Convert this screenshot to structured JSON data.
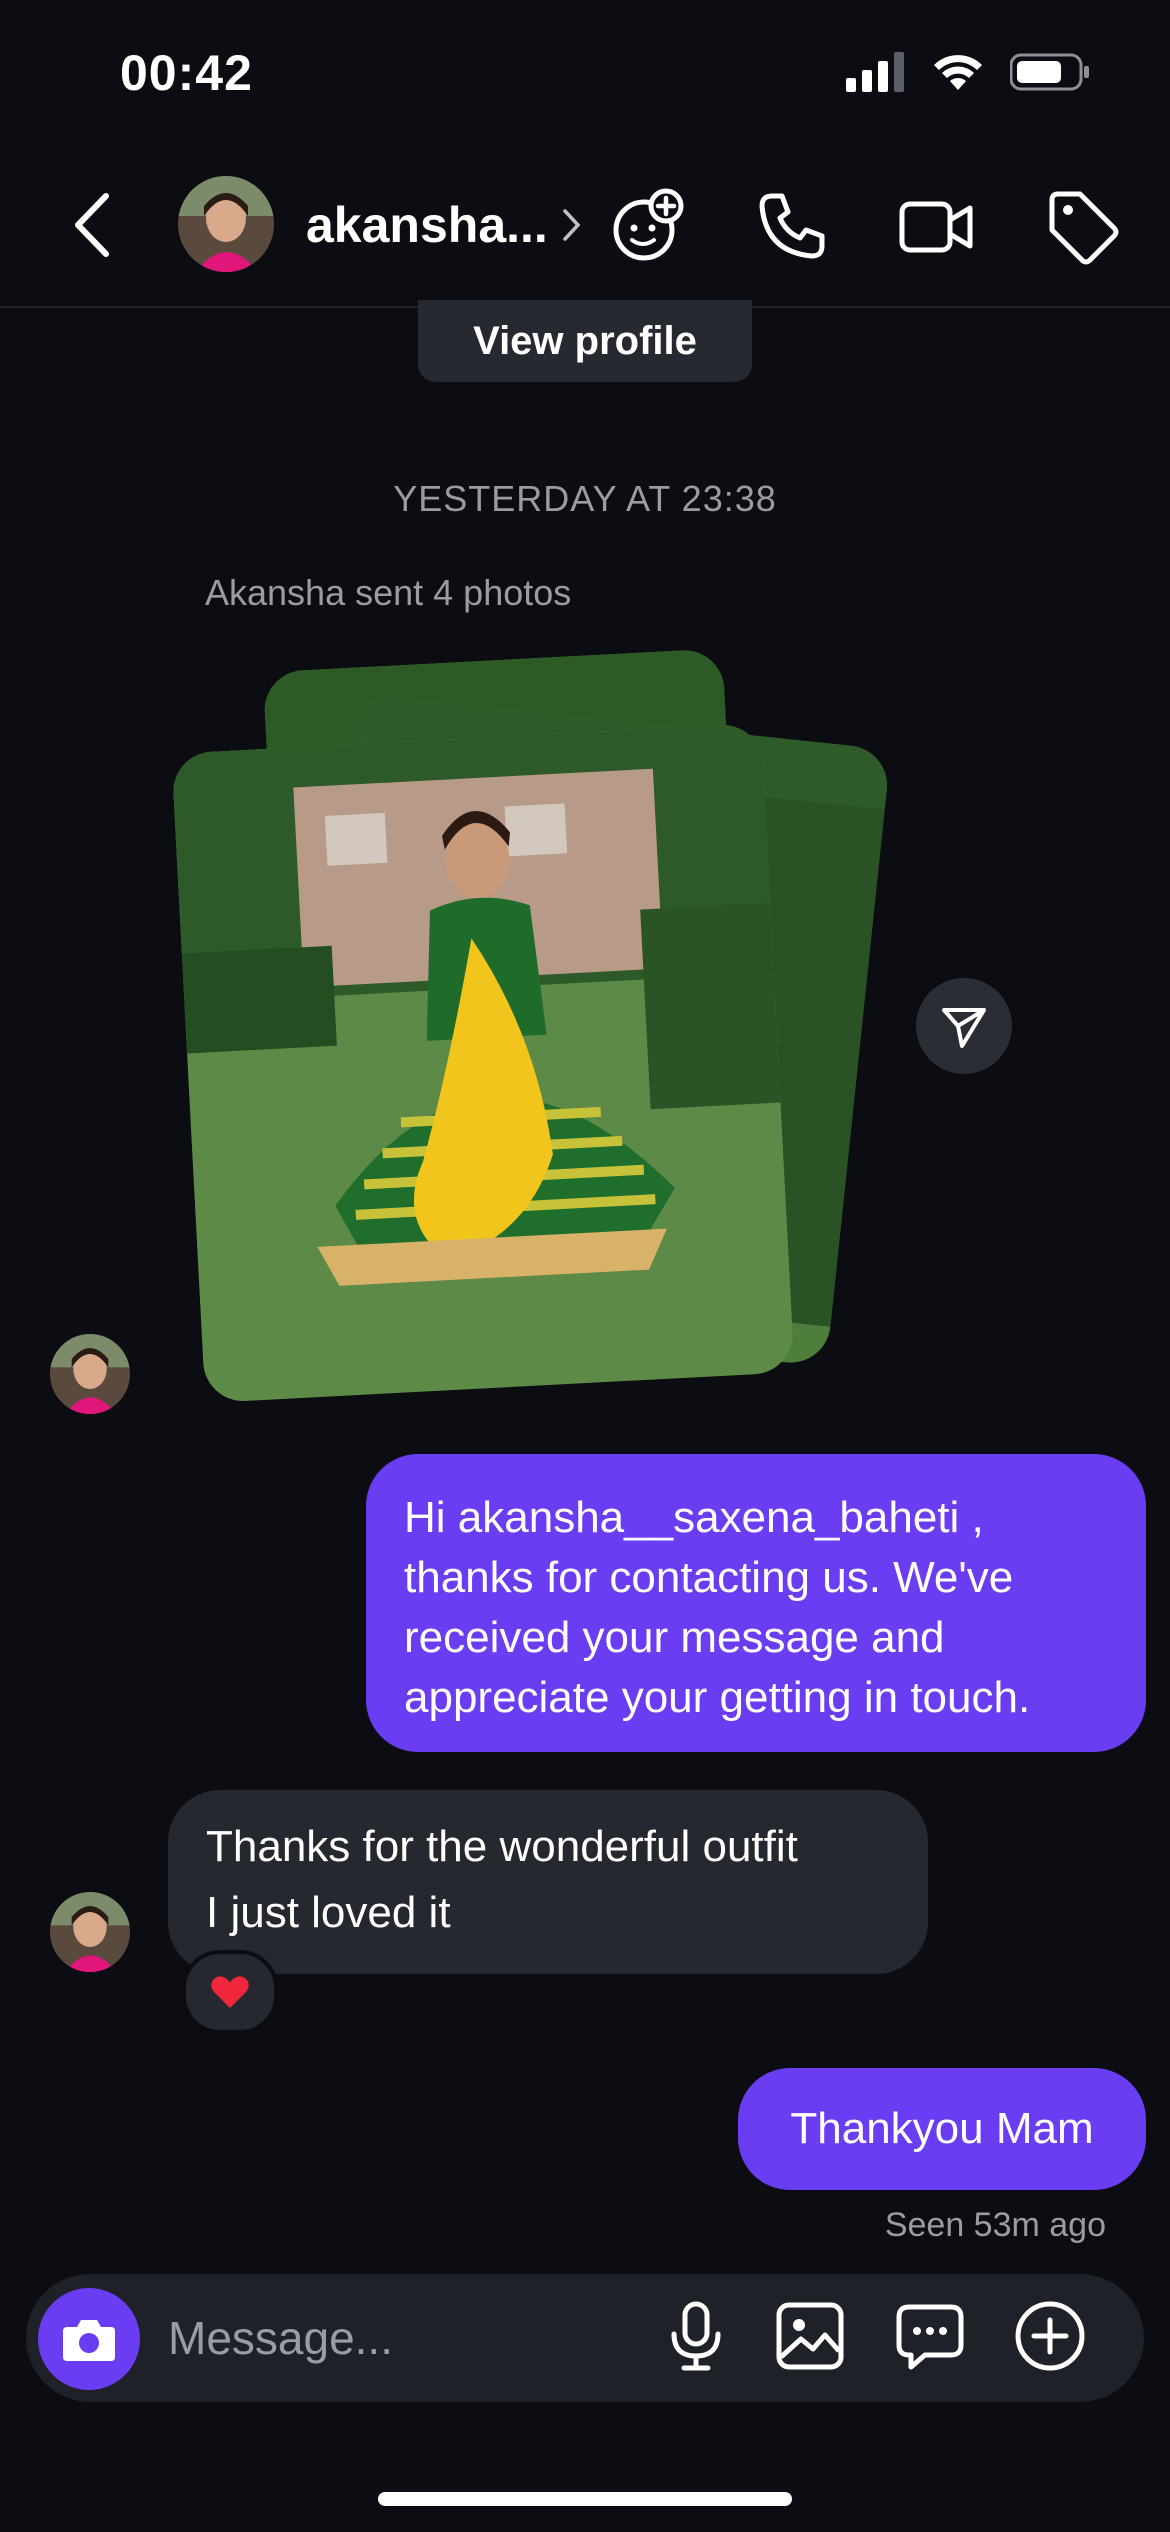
{
  "status_bar": {
    "time": "00:42"
  },
  "header": {
    "contact_name": "akansha...",
    "icons": [
      "back-icon",
      "avatar",
      "add-sticker-icon",
      "phone-icon",
      "video-icon",
      "tag-icon"
    ]
  },
  "thread": {
    "view_profile_label": "View profile",
    "date_separator": "YESTERDAY AT 23:38",
    "photos_note": "Akansha sent 4 photos",
    "outgoing_1_lines": [
      "Hi akansha__saxena_baheti  ,",
      "thanks for contacting us. We've",
      "received your message and",
      "appreciate your getting in touch."
    ],
    "incoming_1_lines": [
      "Thanks for the wonderful outfit",
      "I just loved it"
    ],
    "reaction": "❤️",
    "outgoing_2": "Thankyou Mam",
    "seen_status": "Seen 53m ago"
  },
  "composer": {
    "placeholder": "Message..."
  },
  "colors": {
    "accent": "#6b3df2",
    "background": "#0b0d12",
    "incoming_bubble": "#25282e"
  }
}
